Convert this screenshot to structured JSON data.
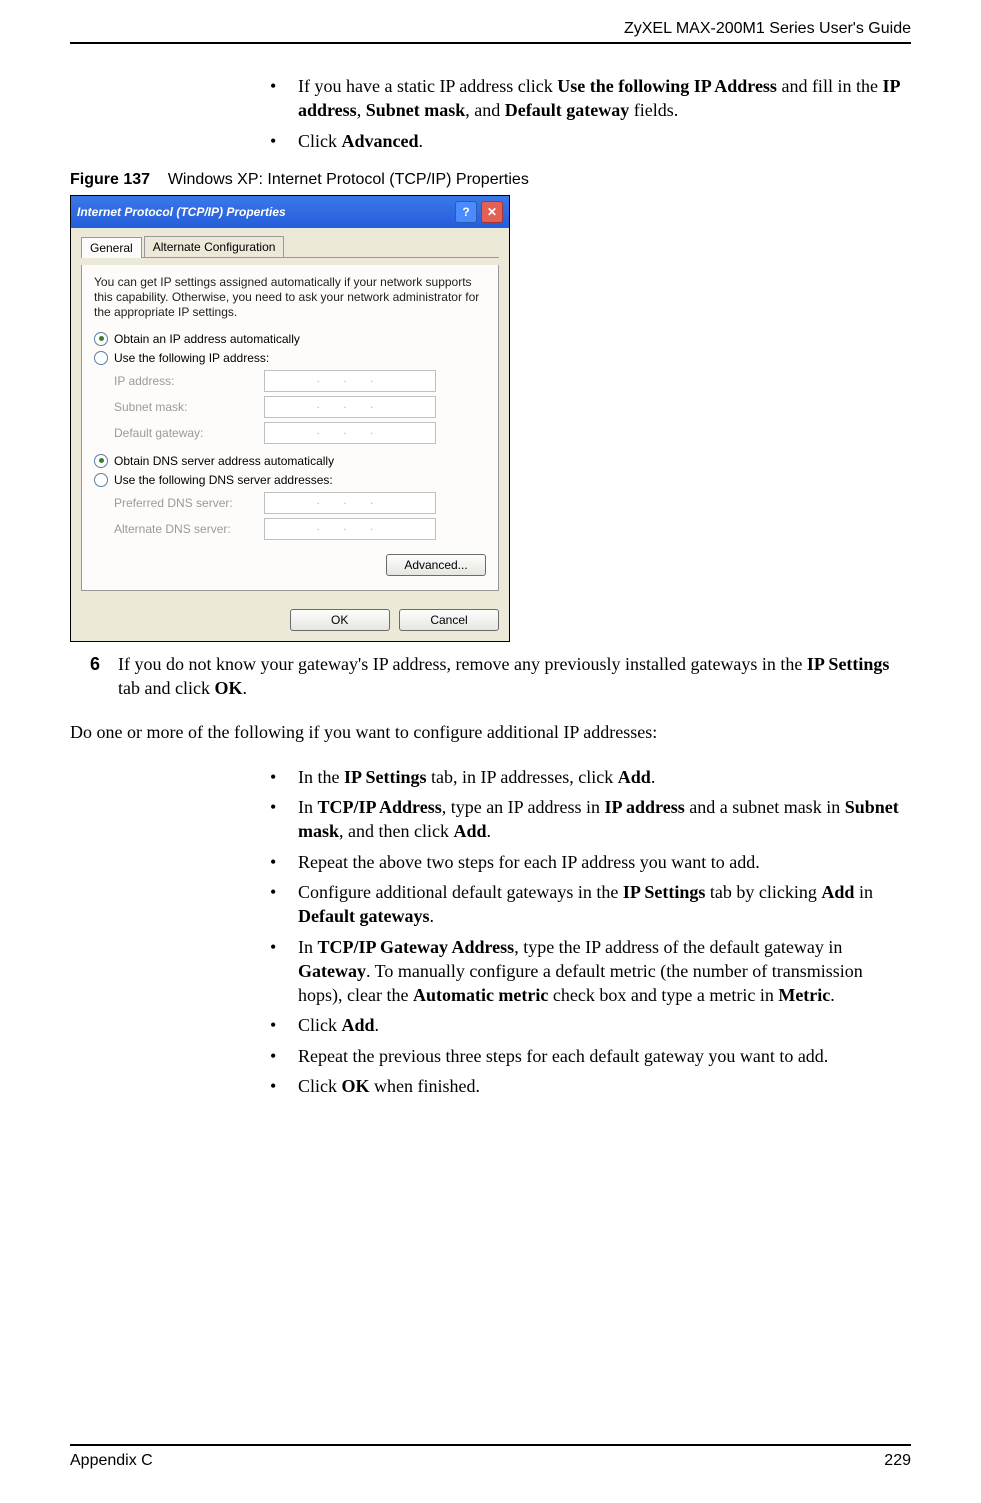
{
  "header": {
    "guide_title": "ZyXEL MAX-200M1 Series User's Guide"
  },
  "footer": {
    "section": "Appendix C",
    "page_number": "229"
  },
  "intro_bullets": [
    {
      "parts": [
        "If you have a static IP address click ",
        {
          "b": "Use the following IP Address"
        },
        " and fill in the ",
        {
          "b": "IP address"
        },
        ", ",
        {
          "b": "Subnet mask"
        },
        ", and ",
        {
          "b": "Default gateway"
        },
        " fields."
      ]
    },
    {
      "parts": [
        "Click ",
        {
          "b": "Advanced"
        },
        "."
      ]
    }
  ],
  "figure": {
    "label": "Figure 137",
    "caption": "Windows XP: Internet Protocol (TCP/IP) Properties"
  },
  "dialog": {
    "title": "Internet Protocol (TCP/IP) Properties",
    "help_glyph": "?",
    "close_glyph": "✕",
    "tabs": {
      "general": "General",
      "alt": "Alternate Configuration"
    },
    "desc": "You can get IP settings assigned automatically if your network supports this capability. Otherwise, you need to ask your network administrator for the appropriate IP settings.",
    "radio_ip_auto": "Obtain an IP address automatically",
    "radio_ip_manual": "Use the following IP address:",
    "fields_ip": {
      "ip": "IP address:",
      "subnet": "Subnet mask:",
      "gateway": "Default gateway:"
    },
    "radio_dns_auto": "Obtain DNS server address automatically",
    "radio_dns_manual": "Use the following DNS server addresses:",
    "fields_dns": {
      "pref": "Preferred DNS server:",
      "alt": "Alternate DNS server:"
    },
    "ip_placeholder": ".   .   .",
    "advanced_btn": "Advanced...",
    "ok_btn": "OK",
    "cancel_btn": "Cancel"
  },
  "step6": {
    "num": "6",
    "parts": [
      "If you do not know your gateway's IP address, remove any previously installed gateways in the ",
      {
        "b": "IP Settings"
      },
      " tab and click ",
      {
        "b": "OK"
      },
      "."
    ]
  },
  "mid_para": "Do one or more of the following if you want to configure additional IP addresses:",
  "more_bullets": [
    {
      "parts": [
        "In the ",
        {
          "b": "IP Settings"
        },
        " tab, in IP addresses, click ",
        {
          "b": "Add"
        },
        "."
      ]
    },
    {
      "parts": [
        "In ",
        {
          "b": "TCP/IP Address"
        },
        ", type an IP address in ",
        {
          "b": "IP address"
        },
        " and a subnet mask in ",
        {
          "b": "Subnet mask"
        },
        ", and then click ",
        {
          "b": "Add"
        },
        "."
      ]
    },
    {
      "parts": [
        "Repeat the above two steps for each IP address you want to add."
      ]
    },
    {
      "parts": [
        "Configure additional default gateways in the ",
        {
          "b": "IP Settings"
        },
        " tab by clicking ",
        {
          "b": "Add"
        },
        " in ",
        {
          "b": "Default gateways"
        },
        "."
      ]
    },
    {
      "parts": [
        "In ",
        {
          "b": "TCP/IP Gateway Address"
        },
        ", type the IP address of the default gateway in ",
        {
          "b": "Gateway"
        },
        ". To manually configure a default metric (the number of transmission hops), clear the ",
        {
          "b": "Automatic metric"
        },
        " check box and type a metric in ",
        {
          "b": "Metric"
        },
        "."
      ]
    },
    {
      "parts": [
        "Click ",
        {
          "b": "Add"
        },
        "."
      ]
    },
    {
      "parts": [
        "Repeat the previous three steps for each default gateway you want to add."
      ]
    },
    {
      "parts": [
        "Click ",
        {
          "b": "OK"
        },
        " when finished."
      ]
    }
  ]
}
